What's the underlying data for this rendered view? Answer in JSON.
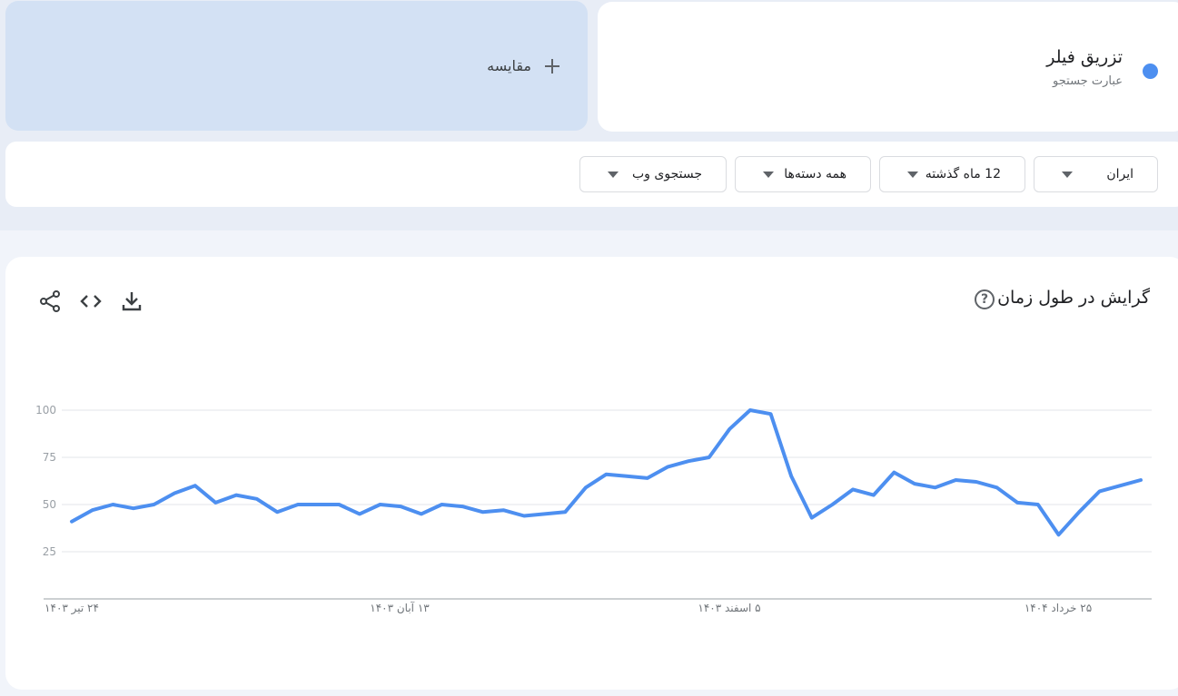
{
  "search_term": {
    "title": "تزریق فیلر",
    "subtitle": "عبارت جستجو",
    "color": "#4d8ff0"
  },
  "compare": {
    "label": "مقایسه",
    "icon": "plus-icon",
    "background": "#d3e1f4"
  },
  "filters": {
    "geo": "ایران",
    "time": "12 ماه گذشته",
    "category": "همه دسته‌ها",
    "property": "جستجوی وب",
    "caret_icon": "caret-down-icon"
  },
  "chart_panel": {
    "title": "گرایش در طول زمان",
    "help_icon": "help-circle-icon",
    "help_glyph": "?",
    "tools": [
      "share-icon",
      "embed-code-icon",
      "download-icon"
    ]
  },
  "chart_data": {
    "type": "line",
    "title": "گرایش در طول زمان",
    "x_tick_labels": [
      "۲۴ تیر ۱۴۰۳",
      "۱۳ آبان ۱۴۰۳",
      "۵ اسفند ۱۴۰۳",
      "۲۵ خرداد ۱۴۰۴"
    ],
    "y_ticks": [
      25,
      50,
      75,
      100
    ],
    "ylim": [
      0,
      100
    ],
    "grid": true,
    "series": [
      {
        "color": "#4d8ff0",
        "values": [
          41,
          47,
          50,
          48,
          50,
          56,
          60,
          51,
          55,
          53,
          46,
          50,
          50,
          50,
          45,
          50,
          49,
          45,
          50,
          49,
          46,
          47,
          44,
          45,
          46,
          59,
          66,
          65,
          64,
          70,
          73,
          75,
          90,
          100,
          98,
          65,
          43,
          50,
          58,
          55,
          67,
          61,
          59,
          63,
          62,
          59,
          51,
          50,
          34,
          46,
          57,
          60,
          63
        ]
      }
    ]
  }
}
